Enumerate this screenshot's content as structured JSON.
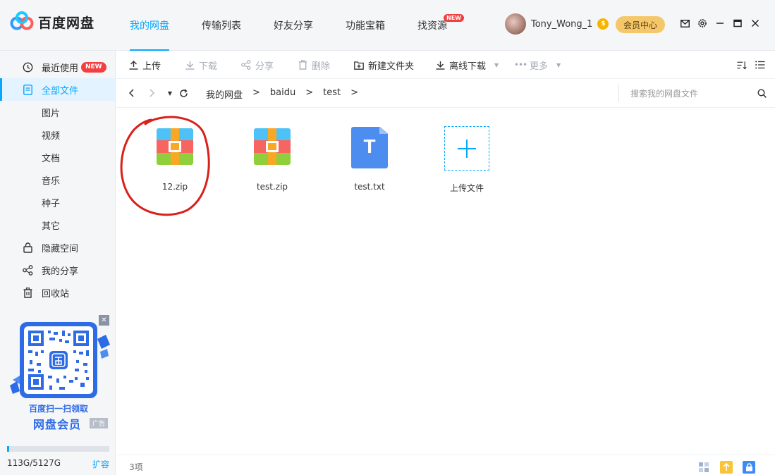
{
  "app": {
    "logo_text": "百度网盘",
    "accent_color": "#06a7ff"
  },
  "nav": {
    "tabs": [
      {
        "label": "我的网盘",
        "active": true
      },
      {
        "label": "传输列表"
      },
      {
        "label": "好友分享"
      },
      {
        "label": "功能宝箱"
      },
      {
        "label": "找资源",
        "badge": "NEW"
      }
    ]
  },
  "user": {
    "name": "Tony_Wong_1",
    "coin_icon": "coin-icon",
    "vip_button": "会员中心"
  },
  "sidebar": {
    "items": [
      {
        "label": "最近使用",
        "icon": "clock-icon",
        "badge": "NEW"
      },
      {
        "label": "全部文件",
        "icon": "document-icon",
        "active": true
      },
      {
        "label": "图片"
      },
      {
        "label": "视频"
      },
      {
        "label": "文档"
      },
      {
        "label": "音乐"
      },
      {
        "label": "种子"
      },
      {
        "label": "其它"
      },
      {
        "label": "隐藏空间",
        "icon": "lock-icon"
      },
      {
        "label": "我的分享",
        "icon": "share-icon"
      },
      {
        "label": "回收站",
        "icon": "trash-icon"
      }
    ],
    "promo": {
      "line1": "百度扫一扫领取",
      "line2": "网盘会员",
      "ad_label": "广告"
    },
    "storage": {
      "text": "113G/5127G",
      "used_fraction": 0.022,
      "expand_label": "扩容"
    }
  },
  "toolbar": {
    "upload": "上传",
    "download": "下载",
    "share": "分享",
    "delete": "删除",
    "new_folder": "新建文件夹",
    "offline_download": "离线下载",
    "more": "更多"
  },
  "path": {
    "crumbs": [
      "我的网盘",
      "baidu",
      "test"
    ],
    "search_placeholder": "搜索我的网盘文件"
  },
  "files": [
    {
      "name": "12.zip",
      "type": "zip",
      "circled": true
    },
    {
      "name": "test.zip",
      "type": "zip"
    },
    {
      "name": "test.txt",
      "type": "txt"
    },
    {
      "name": "上传文件",
      "type": "upload"
    }
  ],
  "status": {
    "count": "3项"
  }
}
